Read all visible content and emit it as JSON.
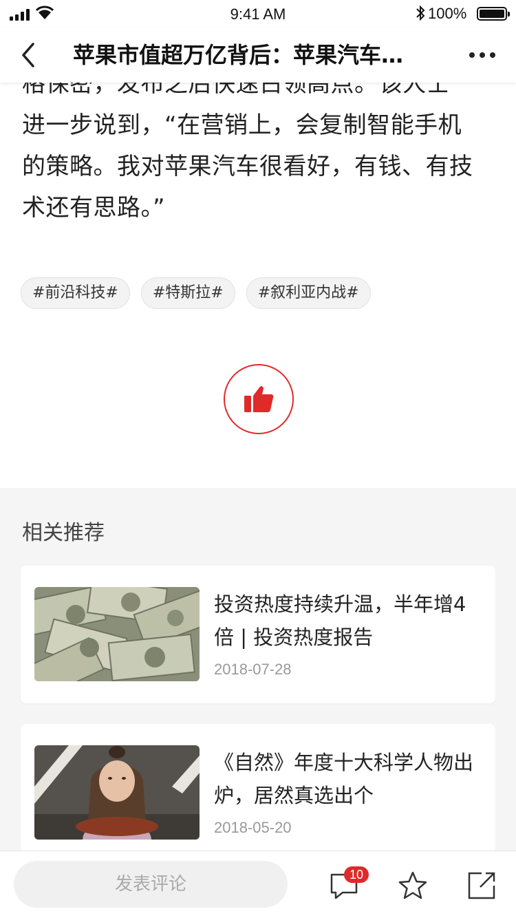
{
  "status_bar": {
    "time": "9:41 AM",
    "battery": "100%"
  },
  "nav": {
    "title": "苹果市值超万亿背后：苹果汽车…",
    "back_icon": "chevron-left-icon",
    "more_icon": "more-horizontal-icon"
  },
  "article": {
    "lines": [
      "格保密，发布之后快速占领高点。”该人士",
      "进一步说到，“在营销上，会复制智能手机",
      "的策略。我对苹果汽车很看好，有钱、有技",
      "术还有思路。”"
    ]
  },
  "tags": [
    "#前沿科技#",
    "#特斯拉#",
    "#叙利亚内战#"
  ],
  "like": {
    "icon": "thumbs-up-icon",
    "color": "#e02a2a"
  },
  "recommend": {
    "heading": "相关推荐",
    "items": [
      {
        "title": "投资热度持续升温，半年增4倍 | 投资热度报告",
        "date": "2018-07-28",
        "thumb": "money-photo"
      },
      {
        "title": "《自然》年度十大科学人物出炉，居然真选出个",
        "date": "2018-05-20",
        "thumb": "girl-photo"
      }
    ]
  },
  "bottom_bar": {
    "comment_placeholder": "发表评论",
    "comment_count": "10"
  },
  "colors": {
    "accent": "#e02a2a",
    "section_bg": "#f5f5f5"
  }
}
